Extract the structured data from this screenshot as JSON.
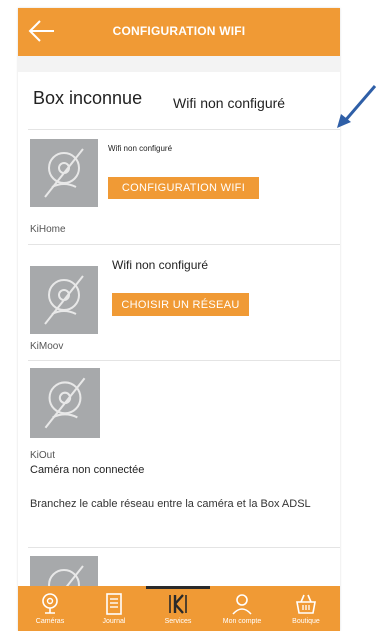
{
  "header": {
    "title": "CONFIGURATION WIFI"
  },
  "box": {
    "title": "Box inconnue",
    "status": "Wifi non configuré"
  },
  "devices": [
    {
      "name": "KiHome",
      "status": "Wifi non configuré",
      "button": "CONFIGURATION WIFI"
    },
    {
      "name": "KiMoov",
      "status": "Wifi non configuré",
      "button": "CHOISIR UN RÉSEAU"
    },
    {
      "name": "KiOut",
      "status": "Caméra non connectée",
      "message": "Branchez le cable réseau entre la caméra et la Box ADSL"
    }
  ],
  "nav": [
    {
      "label": "Caméras",
      "icon": "camera-icon"
    },
    {
      "label": "Journal",
      "icon": "journal-icon"
    },
    {
      "label": "Services",
      "icon": "k-logo-icon",
      "active": true
    },
    {
      "label": "Mon compte",
      "icon": "user-icon"
    },
    {
      "label": "Boutique",
      "icon": "basket-icon"
    }
  ],
  "colors": {
    "accent": "#f09a35",
    "thumb": "#a7a9ab",
    "annotation_arrow": "#2f5fa7"
  }
}
